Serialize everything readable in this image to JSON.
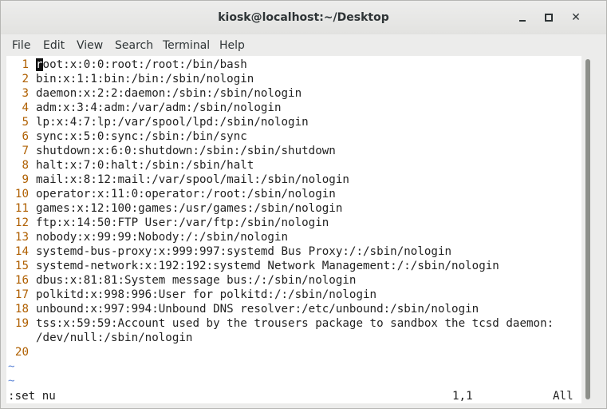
{
  "window": {
    "title": "kiosk@localhost:~/Desktop"
  },
  "menu": [
    "File",
    "Edit",
    "View",
    "Search",
    "Terminal",
    "Help"
  ],
  "lines": [
    {
      "num": "1",
      "text": "root:x:0:0:root:/root:/bin/bash"
    },
    {
      "num": "2",
      "text": "bin:x:1:1:bin:/bin:/sbin/nologin"
    },
    {
      "num": "3",
      "text": "daemon:x:2:2:daemon:/sbin:/sbin/nologin"
    },
    {
      "num": "4",
      "text": "adm:x:3:4:adm:/var/adm:/sbin/nologin"
    },
    {
      "num": "5",
      "text": "lp:x:4:7:lp:/var/spool/lpd:/sbin/nologin"
    },
    {
      "num": "6",
      "text": "sync:x:5:0:sync:/sbin:/bin/sync"
    },
    {
      "num": "7",
      "text": "shutdown:x:6:0:shutdown:/sbin:/sbin/shutdown"
    },
    {
      "num": "8",
      "text": "halt:x:7:0:halt:/sbin:/sbin/halt"
    },
    {
      "num": "9",
      "text": "mail:x:8:12:mail:/var/spool/mail:/sbin/nologin"
    },
    {
      "num": "10",
      "text": "operator:x:11:0:operator:/root:/sbin/nologin"
    },
    {
      "num": "11",
      "text": "games:x:12:100:games:/usr/games:/sbin/nologin"
    },
    {
      "num": "12",
      "text": "ftp:x:14:50:FTP User:/var/ftp:/sbin/nologin"
    },
    {
      "num": "13",
      "text": "nobody:x:99:99:Nobody:/:/sbin/nologin"
    },
    {
      "num": "14",
      "text": "systemd-bus-proxy:x:999:997:systemd Bus Proxy:/:/sbin/nologin"
    },
    {
      "num": "15",
      "text": "systemd-network:x:192:192:systemd Network Management:/:/sbin/nologin"
    },
    {
      "num": "16",
      "text": "dbus:x:81:81:System message bus:/:/sbin/nologin"
    },
    {
      "num": "17",
      "text": "polkitd:x:998:996:User for polkitd:/:/sbin/nologin"
    },
    {
      "num": "18",
      "text": "unbound:x:997:994:Unbound DNS resolver:/etc/unbound:/sbin/nologin"
    },
    {
      "num": "19",
      "text": "tss:x:59:59:Account used by the trousers package to sandbox the tcsd daemon:",
      "wrap": "/dev/null:/sbin/nologin"
    },
    {
      "num": "20",
      "text": ""
    }
  ],
  "tildes": [
    "~",
    "~"
  ],
  "status": {
    "command": ":set nu",
    "position": "1,1",
    "scroll": "All"
  }
}
